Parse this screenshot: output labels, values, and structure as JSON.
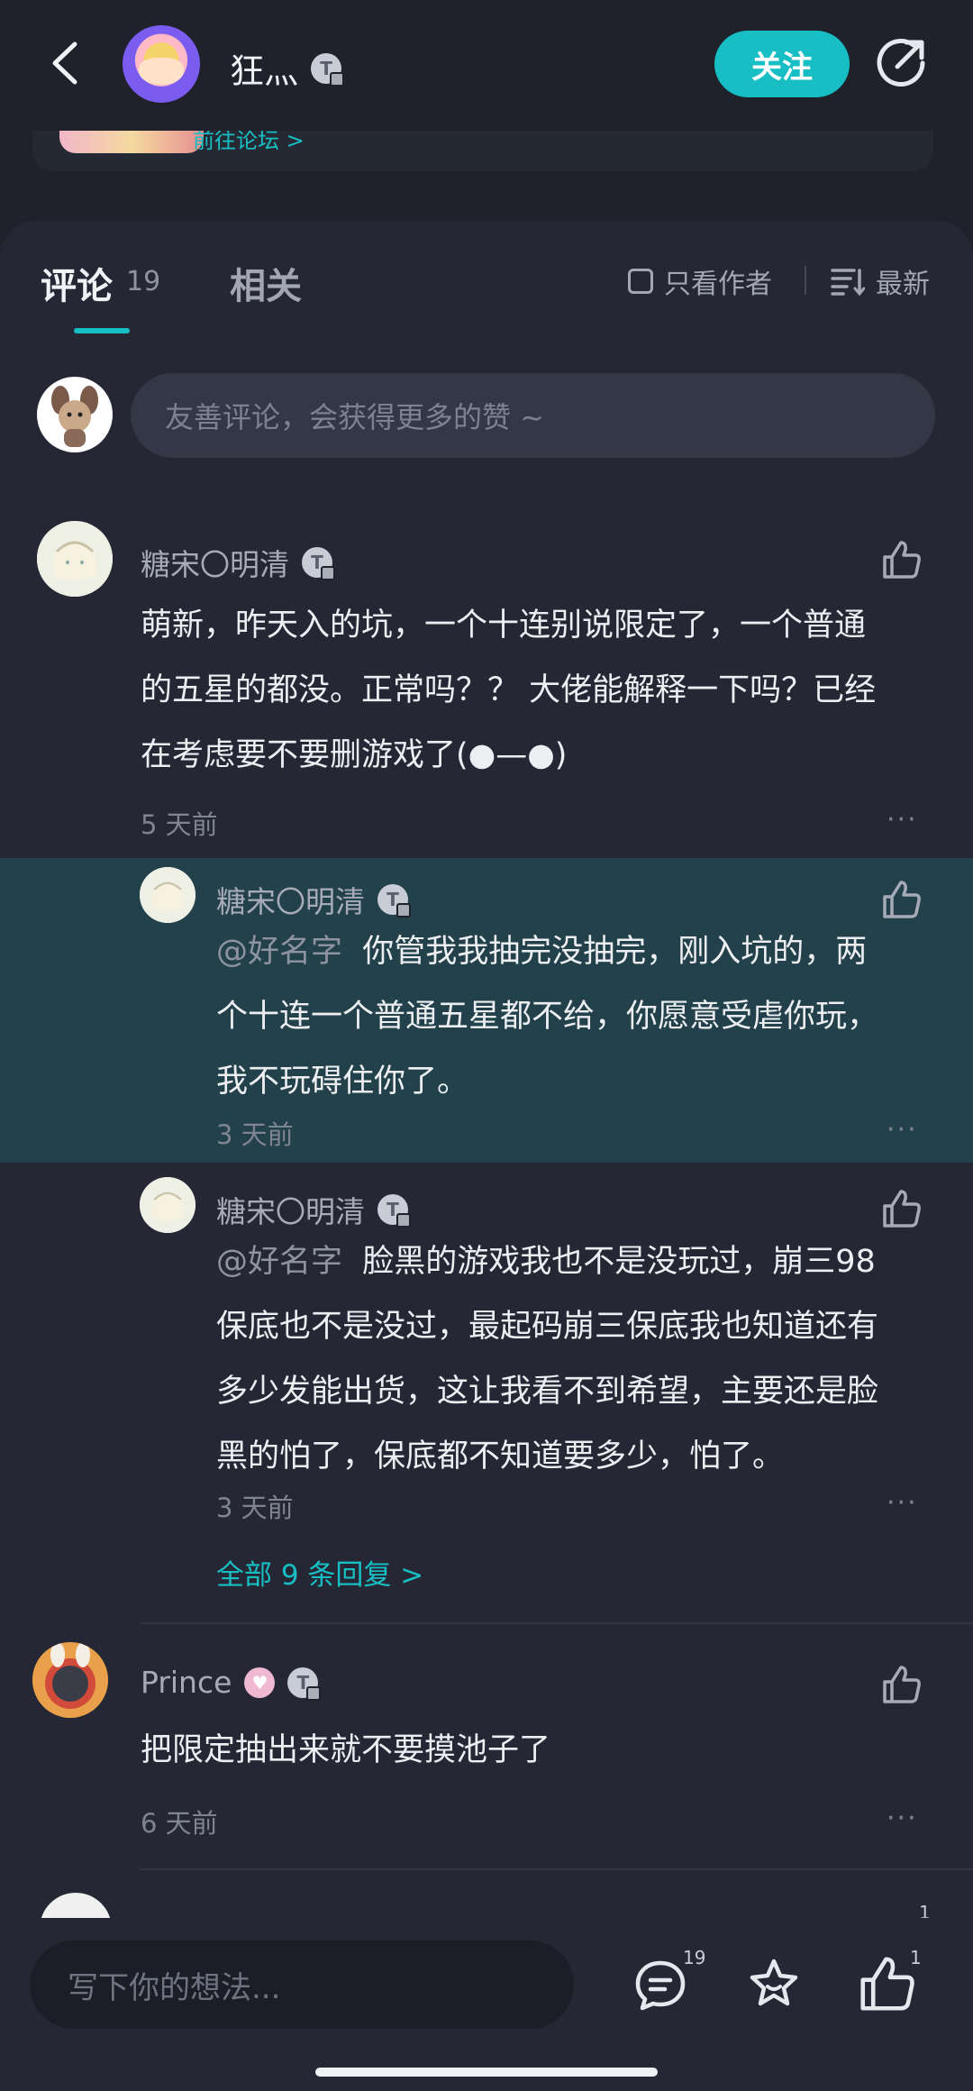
{
  "header": {
    "username": "狂灬",
    "follow_label": "关注"
  },
  "forum_card": {
    "link_label": "前往论坛 >"
  },
  "tabs": {
    "comments_label": "评论",
    "comments_count": "19",
    "related_label": "相关",
    "author_only_label": "只看作者",
    "sort_label": "最新"
  },
  "comment_input": {
    "placeholder": "友善评论，会获得更多的赞 ~"
  },
  "comments": [
    {
      "user": "糖宋〇明清",
      "text": [
        "萌新，昨天入的坑，一个十连别说限定了，一个普通",
        "的五星的都没。正常吗？？ 大佬能解释一下吗？已经",
        "在考虑要不要删游戏了(●—●)"
      ],
      "time": "5 天前",
      "more": "···",
      "replies": [
        {
          "user": "糖宋〇明清",
          "mention": "@好名字",
          "text": [
            "你管我我抽完没抽完，刚入坑的，两",
            "个十连一个普通五星都不给，你愿意受虐你玩，",
            "我不玩碍住你了。"
          ],
          "time": "3 天前",
          "more": "···"
        },
        {
          "user": "糖宋〇明清",
          "mention": "@好名字",
          "text": [
            "脸黑的游戏我也不是没玩过，崩三98",
            "保底也不是没过，最起码崩三保底我也知道还有",
            "多少发能出货，这让我看不到希望，主要还是脸",
            "黑的怕了，保底都不知道要多少，怕了。"
          ],
          "time": "3 天前",
          "more": "···"
        }
      ],
      "all_replies_label": "全部 9 条回复 >"
    },
    {
      "user": "Prince",
      "text": [
        "把限定抽出来就不要摸池子了"
      ],
      "time": "6 天前",
      "more": "···"
    }
  ],
  "peek_like_count": "1",
  "bottom_bar": {
    "write_placeholder": "写下你的想法...",
    "comment_count": "19",
    "like_count": "1",
    "icons": [
      "comment-icon",
      "star-icon",
      "like-icon"
    ]
  },
  "colors": {
    "accent": "#17bfc4",
    "background": "#1f222b",
    "panel": "#252834",
    "highlight": "#22414a"
  }
}
